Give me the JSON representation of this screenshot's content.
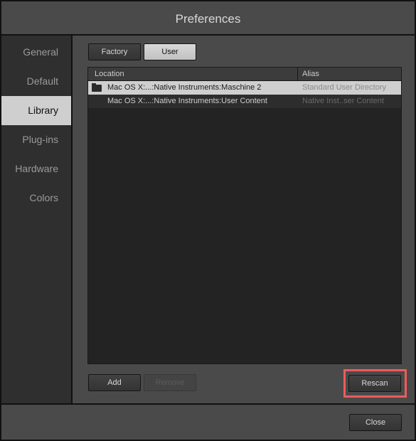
{
  "window": {
    "title": "Preferences"
  },
  "sidebar": {
    "items": [
      {
        "label": "General",
        "active": false
      },
      {
        "label": "Default",
        "active": false
      },
      {
        "label": "Library",
        "active": true
      },
      {
        "label": "Plug-ins",
        "active": false
      },
      {
        "label": "Hardware",
        "active": false
      },
      {
        "label": "Colors",
        "active": false
      }
    ]
  },
  "library": {
    "tabs": {
      "factory": "Factory",
      "user": "User",
      "selected": "User"
    },
    "table": {
      "columns": [
        "Location",
        "Alias"
      ],
      "rows": [
        {
          "location": "Mac OS X:...:Native Instruments:Maschine 2",
          "alias": "Standard User Directory",
          "icon": "folder-icon",
          "selected": true
        },
        {
          "location": "Mac OS X:...:Native Instruments:User Content",
          "alias": "Native Inst..ser Content",
          "selected": false
        }
      ]
    },
    "buttons": {
      "add": "Add",
      "remove": "Remove",
      "rescan": "Rescan"
    }
  },
  "footer": {
    "close": "Close"
  },
  "colors": {
    "highlight": "#f25a5a",
    "selected_row": "#cfcfcf"
  }
}
